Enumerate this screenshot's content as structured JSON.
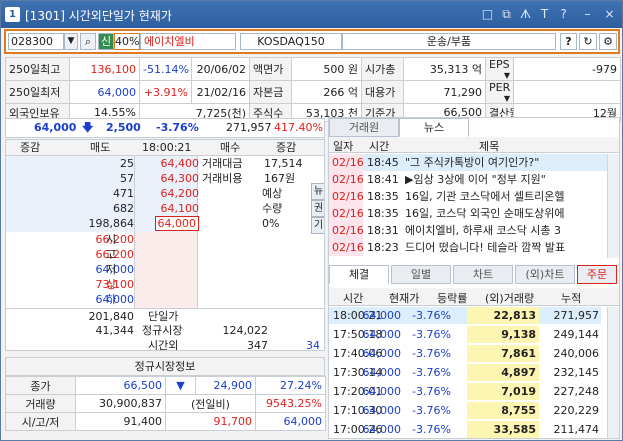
{
  "window": {
    "badge": "1",
    "title": "[1301] 시간외단일가 현재가",
    "ctrl_icons": [
      "□",
      "⧉",
      "ᗑ",
      "T",
      "?",
      "–",
      "×"
    ]
  },
  "toolbar": {
    "code": "028300",
    "tag": "신",
    "margin": "40%",
    "name": "에이치엘비",
    "index": "KOSDAQ150",
    "sector": "운송/부품",
    "help": "?"
  },
  "info": {
    "r1": [
      "250일최고",
      "136,100",
      "-51.14%",
      "20/06/02",
      "액면가",
      "500 원",
      "시가총",
      "35,313 억",
      "EPS",
      "-979"
    ],
    "r2": [
      "250일최저",
      "64,000",
      "+3.91%",
      "21/02/16",
      "자본금",
      "266 억",
      "대용가",
      "71,290",
      "PER",
      ""
    ],
    "r3": [
      "외국인보유",
      "14.55%",
      "7,725(천)",
      "주식수",
      "53,103 천",
      "기준가",
      "66,500",
      "결산월",
      "12월"
    ]
  },
  "summary": {
    "price": "64,000",
    "arrow": "🡇",
    "change": "2,500",
    "rate": "-3.76%",
    "volume": "271,957",
    "ratio": "417.40%"
  },
  "orderbook": {
    "header": [
      "증감",
      "매도",
      "18:00:21",
      "매수",
      "증감"
    ],
    "asks": [
      [
        "25",
        "64,400"
      ],
      [
        "57",
        "64,300"
      ],
      [
        "471",
        "64,200"
      ],
      [
        "682",
        "64,100"
      ],
      [
        "198,864",
        "64,000"
      ]
    ],
    "info_left": [
      "거래대금",
      "거래비용"
    ],
    "info_vals": [
      "17,514",
      "167원"
    ],
    "expect": [
      "예상",
      "수량",
      "0%"
    ],
    "side_btns": [
      "뉴",
      "권",
      "기"
    ],
    "prices": [
      [
        "66,200",
        "시"
      ],
      [
        "66,200",
        "고"
      ],
      [
        "64,000",
        "저"
      ],
      [
        "73,100",
        "상"
      ],
      [
        "64,000",
        "하"
      ]
    ],
    "footer": {
      "ask_total": "201,840",
      "bid_total_label": "단일가",
      "diff": "41,344",
      "regular": "정규시장",
      "regular_val": "124,022",
      "time_label": "시간외",
      "time_val": "347",
      "time_last": "34"
    }
  },
  "regular": {
    "title": "정규시장정보",
    "rows": [
      [
        "종가",
        "66,500",
        "▼",
        "24,900",
        "27.24%"
      ],
      [
        "거래량",
        "30,900,837",
        "(전일비)",
        "9543.25%",
        ""
      ],
      [
        "시/고/저",
        "91,400",
        "91,700",
        "64,000",
        ""
      ]
    ]
  },
  "right": {
    "tabs_top": [
      "거래원",
      "뉴스"
    ],
    "news_header": [
      "일자",
      "시간",
      "제목"
    ],
    "news": [
      [
        "02/16",
        "18:45",
        "\"그 주식카톡방이 여기인가?\""
      ],
      [
        "02/16",
        "18:41",
        "▶임상 3상에 이어 \"정부 지원\""
      ],
      [
        "02/16",
        "18:35",
        "16일, 기관 코스닥에서 셀트리온헬"
      ],
      [
        "02/16",
        "18:35",
        "16일, 코스닥 외국인 순매도상위에"
      ],
      [
        "02/16",
        "18:31",
        "에이치엘비, 하루새 코스닥 시총 3"
      ],
      [
        "02/16",
        "18:23",
        "드디어 떴습니다! 테슬라 깜짝 발표"
      ]
    ],
    "tabs_bottom": [
      "체결",
      "일별",
      "차트",
      "(외)차트",
      "주문"
    ],
    "trade_header": [
      "시간",
      "현재가",
      "등락률",
      "(외)거래량",
      "누적"
    ],
    "trades": [
      [
        "18:00:21",
        "64,000",
        "-3.76%",
        "22,813",
        "271,957"
      ],
      [
        "17:50:18",
        "64,000",
        "-3.76%",
        "9,138",
        "249,144"
      ],
      [
        "17:40:06",
        "64,000",
        "-3.76%",
        "7,861",
        "240,006"
      ],
      [
        "17:30:14",
        "64,000",
        "-3.76%",
        "4,897",
        "232,145"
      ],
      [
        "17:20:01",
        "64,000",
        "-3.76%",
        "7,019",
        "227,248"
      ],
      [
        "17:10:30",
        "64,000",
        "-3.76%",
        "8,755",
        "220,229"
      ],
      [
        "17:00:26",
        "64,000",
        "-3.76%",
        "33,585",
        "211,474"
      ]
    ]
  }
}
